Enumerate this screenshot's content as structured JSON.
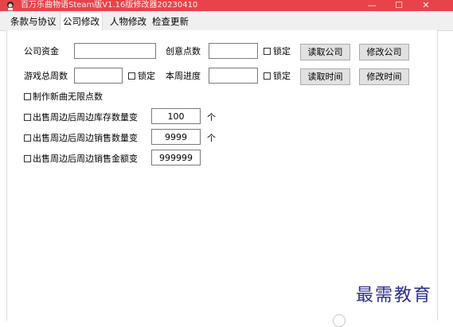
{
  "window": {
    "title": "百万乐曲物语Steam版V1.16版修改器20230410",
    "minimize": "—",
    "maximize": "☐",
    "close": "✕",
    "accent_color": "#e8434a"
  },
  "tabs": [
    {
      "label": "条款与协议",
      "active": false
    },
    {
      "label": "公司修改",
      "active": true
    },
    {
      "label": "人物修改",
      "active": false
    },
    {
      "label": "检查更新",
      "active": false
    }
  ],
  "company": {
    "funds_label": "公司资金",
    "funds_value": "",
    "creativity_label": "创意点数",
    "creativity_value": "",
    "lock_label": "锁定",
    "read_company_button": "读取公司",
    "modify_company_button": "修改公司",
    "total_weeks_label": "游戏总周数",
    "total_weeks_value": "",
    "week_progress_label": "本周进度",
    "week_progress_value": "",
    "read_time_button": "读取时间",
    "modify_time_button": "修改时间",
    "unlimited_points_label": "制作新曲无限点数",
    "stock_change_label": "出售周边后周边库存数量变",
    "stock_change_value": "100",
    "stock_unit": "个",
    "sales_change_label": "出售周边后周边销售数量变",
    "sales_change_value": "9999",
    "sales_unit": "个",
    "amount_change_label": "出售周边后周边销售金额变",
    "amount_change_value": "999999"
  },
  "watermark": "最需教育"
}
